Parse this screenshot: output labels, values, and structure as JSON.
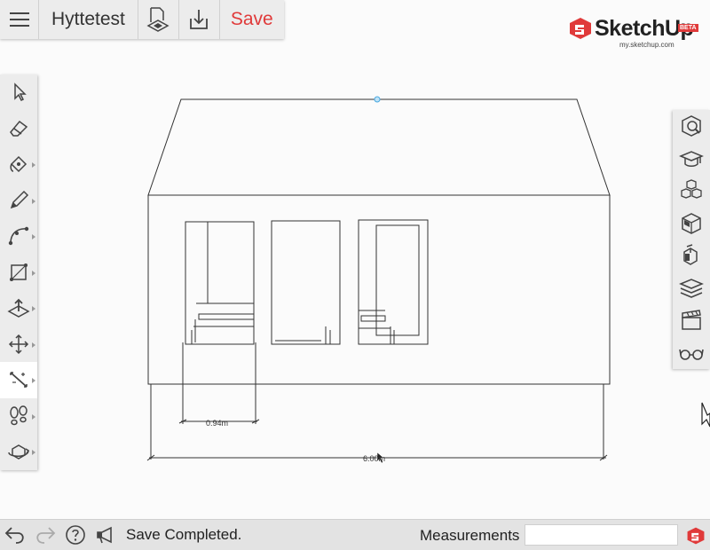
{
  "toolbar": {
    "file_title": "Hyttetest",
    "save_label": "Save",
    "menu_icon": "hamburger-icon",
    "model_info_icon": "model-info-icon",
    "export_icon": "download-icon"
  },
  "logo": {
    "name": "SketchUp",
    "badge": "BETA",
    "sub": "my.sketchup.com"
  },
  "left_tools": [
    {
      "name": "select-tool",
      "icon": "arrow-cursor-icon"
    },
    {
      "name": "eraser-tool",
      "icon": "eraser-icon"
    },
    {
      "name": "paint-tool",
      "icon": "paint-bucket-icon"
    },
    {
      "name": "pencil-tool",
      "icon": "pencil-icon"
    },
    {
      "name": "arc-tool",
      "icon": "arc-icon"
    },
    {
      "name": "rectangle-tool",
      "icon": "rectangle-icon"
    },
    {
      "name": "push-pull-tool",
      "icon": "push-pull-icon"
    },
    {
      "name": "move-tool",
      "icon": "move-icon"
    },
    {
      "name": "tape-measure-tool",
      "icon": "tape-measure-icon"
    },
    {
      "name": "walk-tool",
      "icon": "footprints-icon"
    },
    {
      "name": "orbit-tool",
      "icon": "orbit-icon"
    }
  ],
  "right_tools": [
    {
      "name": "entity-info-panel",
      "icon": "entity-info-icon"
    },
    {
      "name": "instructor-panel",
      "icon": "graduation-cap-icon"
    },
    {
      "name": "components-panel",
      "icon": "components-icon"
    },
    {
      "name": "materials-panel",
      "icon": "materials-icon"
    },
    {
      "name": "styles-panel",
      "icon": "styles-icon"
    },
    {
      "name": "layers-panel",
      "icon": "layers-icon"
    },
    {
      "name": "scenes-panel",
      "icon": "clapperboard-icon"
    },
    {
      "name": "display-panel",
      "icon": "glasses-icon"
    }
  ],
  "dimensions": {
    "window_width": "0.94m",
    "wall_width": "6.00m"
  },
  "status": {
    "message": "Save Completed.",
    "measurements_label": "Measurements",
    "measurements_value": ""
  },
  "colors": {
    "accent": "#e03a3a",
    "toolbar_bg": "#ececec",
    "canvas_bg": "#fbfbfb",
    "line": "#333333",
    "inference_point": "#4aa8e0"
  }
}
